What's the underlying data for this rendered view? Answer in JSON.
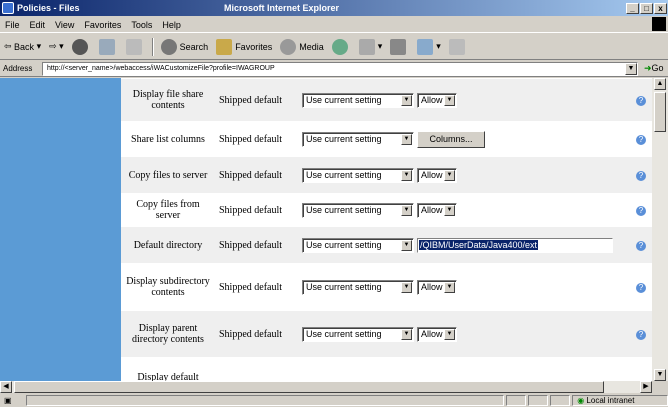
{
  "window": {
    "title_left": "Policies - Files",
    "title_right": "Microsoft Internet Explorer",
    "controls": [
      "_",
      "□",
      "x"
    ]
  },
  "menu": [
    "File",
    "Edit",
    "View",
    "Favorites",
    "Tools",
    "Help"
  ],
  "toolbar": {
    "back": "Back",
    "search": "Search",
    "favorites": "Favorites",
    "media": "Media"
  },
  "address": {
    "label": "Address",
    "url": "http://<server_name>/webaccess/iWACustomizeFile?profile=IWAGROUP",
    "go": "Go"
  },
  "rows": [
    {
      "name": "Display file share contents",
      "default": "Shipped default",
      "setting": "Use current setting",
      "control_type": "select",
      "control_value": "Allow"
    },
    {
      "name": "Share list columns",
      "default": "Shipped default",
      "setting": "Use current setting",
      "control_type": "button",
      "control_value": "Columns..."
    },
    {
      "name": "Copy files to server",
      "default": "Shipped default",
      "setting": "Use current setting",
      "control_type": "select",
      "control_value": "Allow"
    },
    {
      "name": "Copy files from server",
      "default": "Shipped default",
      "setting": "Use current setting",
      "control_type": "select",
      "control_value": "Allow"
    },
    {
      "name": "Default directory",
      "default": "Shipped default",
      "setting": "Use current setting",
      "control_type": "text",
      "control_value": "/QIBM/UserData/Java400/ext"
    },
    {
      "name": "Display subdirectory contents",
      "default": "Shipped default",
      "setting": "Use current setting",
      "control_type": "select",
      "control_value": "Allow"
    },
    {
      "name": "Display parent directory contents",
      "default": "Shipped default",
      "setting": "Use current setting",
      "control_type": "select",
      "control_value": "Allow"
    },
    {
      "name": "Display default",
      "default": "",
      "setting": "",
      "control_type": "none",
      "control_value": ""
    }
  ],
  "status": {
    "zone": "Local intranet"
  }
}
